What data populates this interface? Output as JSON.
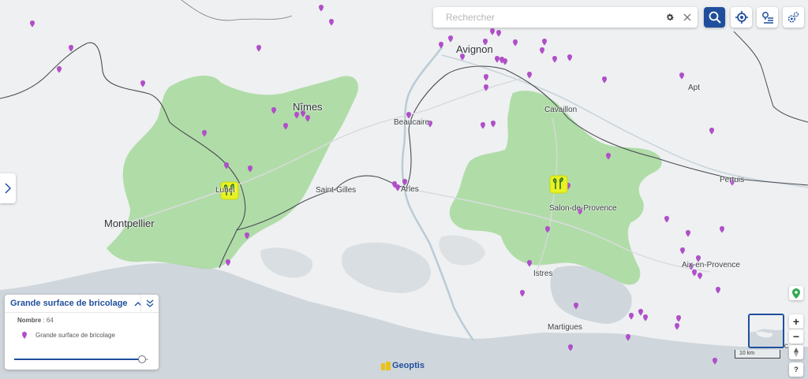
{
  "search": {
    "placeholder": "Rechercher"
  },
  "toolbar": {
    "search_button_icon": "search-icon",
    "locate_button_icon": "locate-icon",
    "layers_button_icon": "route-list-icon",
    "settings_button_icon": "settings-icon"
  },
  "cities": [
    {
      "id": "avignon",
      "label": "Avignon",
      "size": "big"
    },
    {
      "id": "nimes",
      "label": "Nîmes",
      "size": "big"
    },
    {
      "id": "montpellier",
      "label": "Montpellier",
      "size": "big"
    },
    {
      "id": "lunel",
      "label": "Lunel",
      "size": "small"
    },
    {
      "id": "beaucaire",
      "label": "Beaucaire",
      "size": "small"
    },
    {
      "id": "saint-gilles",
      "label": "Saint-Gilles",
      "size": "small"
    },
    {
      "id": "arles",
      "label": "Arles",
      "size": "small"
    },
    {
      "id": "cavaillon",
      "label": "Cavaillon",
      "size": "small"
    },
    {
      "id": "salon",
      "label": "Salon-de-Provence",
      "size": "small"
    },
    {
      "id": "apt",
      "label": "Apt",
      "size": "small"
    },
    {
      "id": "pertuis",
      "label": "Pertuis",
      "size": "small"
    },
    {
      "id": "aix",
      "label": "Aix-en-Provence",
      "size": "small"
    },
    {
      "id": "istres",
      "label": "Istres",
      "size": "small"
    },
    {
      "id": "martigues",
      "label": "Martigues",
      "size": "small"
    },
    {
      "id": "auriol",
      "label": "Auric",
      "size": "small"
    }
  ],
  "legend": {
    "title": "Grande surface de bricolage",
    "count_label": "Nombre",
    "count_sep": " : ",
    "count_value": "64",
    "item_label": "Grande surface de bricolage",
    "slider_value": 0.95
  },
  "brand": {
    "name": "Geoptis"
  },
  "scale": {
    "label": "10 km"
  },
  "controls": {
    "zoom_in": "+",
    "zoom_out": "−",
    "help": "?"
  },
  "colors": {
    "zone_fill": "#a8d9a0",
    "poi_marker": "#b04fc9",
    "accent": "#1f4f9c",
    "highlight_marker": "#e8f222",
    "sea": "#cfd6dc",
    "land": "#eef0f1"
  }
}
